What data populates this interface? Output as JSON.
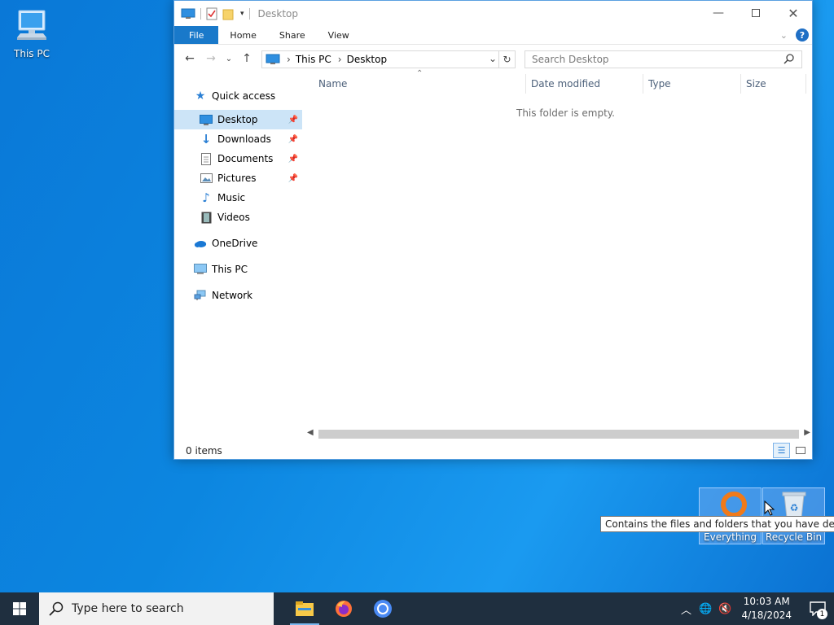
{
  "desktop": {
    "this_pc_label": "This PC",
    "everything_label": "Everything",
    "recycle_bin_label": "Recycle Bin",
    "tooltip": "Contains the files and folders that you have deleted."
  },
  "window": {
    "title": "Desktop",
    "ribbon_tabs": [
      "File",
      "Home",
      "Share",
      "View"
    ],
    "address": {
      "crumbs": [
        "This PC",
        "Desktop"
      ]
    },
    "search_placeholder": "Search Desktop",
    "sidebar": {
      "quick_access": "Quick access",
      "items": [
        {
          "label": "Desktop",
          "pinned": true,
          "selected": true
        },
        {
          "label": "Downloads",
          "pinned": true
        },
        {
          "label": "Documents",
          "pinned": true
        },
        {
          "label": "Pictures",
          "pinned": true
        },
        {
          "label": "Music"
        },
        {
          "label": "Videos"
        }
      ],
      "onedrive": "OneDrive",
      "this_pc": "This PC",
      "network": "Network"
    },
    "columns": [
      "Name",
      "Date modified",
      "Type",
      "Size"
    ],
    "empty_message": "This folder is empty.",
    "status": "0 items"
  },
  "taskbar": {
    "search_placeholder": "Type here to search",
    "time": "10:03 AM",
    "date": "4/18/2024",
    "notification_count": "1"
  }
}
